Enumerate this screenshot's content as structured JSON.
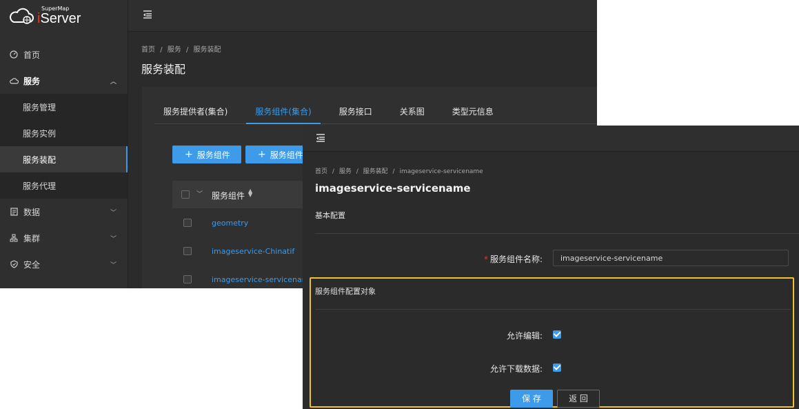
{
  "back_window": {
    "logo": {
      "small": "SuperMap",
      "big": "iServer"
    },
    "sidebar": {
      "items": [
        {
          "label": "首页",
          "icon": "dashboard-icon"
        },
        {
          "label": "服务",
          "icon": "cloud-icon"
        },
        {
          "label": "数据",
          "icon": "database-icon"
        },
        {
          "label": "集群",
          "icon": "cluster-icon"
        },
        {
          "label": "安全",
          "icon": "shield-icon"
        }
      ],
      "sub_items": [
        "服务管理",
        "服务实例",
        "服务装配",
        "服务代理"
      ]
    },
    "breadcrumb": [
      "首页",
      "/",
      "服务",
      "/",
      "服务装配"
    ],
    "page_title": "服务装配",
    "tabs": [
      "服务提供者(集合)",
      "服务组件(集合)",
      "服务接口",
      "关系图",
      "类型元信息"
    ],
    "buttons": [
      "服务组件",
      "服务组件"
    ],
    "table": {
      "header": "服务组件",
      "rows": [
        "geometry",
        "imageservice-Chinatif",
        "imageservice-servicename"
      ]
    }
  },
  "front_window": {
    "breadcrumb": [
      "首页",
      "/",
      "服务",
      "/",
      "服务装配",
      "/",
      "imageservice-servicename"
    ],
    "page_title": "imageservice-servicename",
    "section_basic": "基本配置",
    "name_label": "服务组件名称:",
    "name_required": "*",
    "name_value": "imageservice-servicename",
    "section_config": "服务组件配置对象",
    "allow_edit_label": "允许编辑:",
    "allow_edit": true,
    "allow_download_label": "允许下载数据:",
    "allow_download": true,
    "save_label": "保 存",
    "back_label": "返 回"
  },
  "colors": {
    "accent": "#3d9be9",
    "highlight": "#f2c12e",
    "brand_red": "#e63a2e"
  }
}
